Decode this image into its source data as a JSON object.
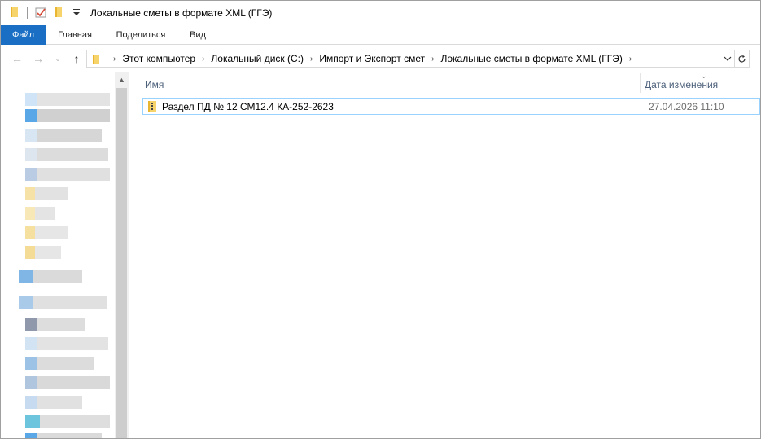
{
  "window": {
    "title": "Локальные сметы в формате XML (ГГЭ)"
  },
  "ribbon": {
    "tabs": [
      {
        "label": "Файл",
        "active": true
      },
      {
        "label": "Главная"
      },
      {
        "label": "Поделиться"
      },
      {
        "label": "Вид"
      }
    ]
  },
  "address": {
    "breadcrumbs": [
      "Этот компьютер",
      "Локальный диск (C:)",
      "Импорт и Экспорт смет",
      "Локальные сметы в формате XML (ГГЭ)"
    ],
    "separator": "›"
  },
  "columns": {
    "name": "Имя",
    "date": "Дата изменения"
  },
  "files": [
    {
      "name": "Раздел ПД № 12 СМ12.4 КА-252-2623",
      "modified": "27.04.2026 11:10",
      "icon": "zip-folder-icon"
    }
  ],
  "colors": {
    "accent": "#1a6fc4",
    "selection_border": "#99d1ff",
    "header_text": "#4c607a"
  }
}
